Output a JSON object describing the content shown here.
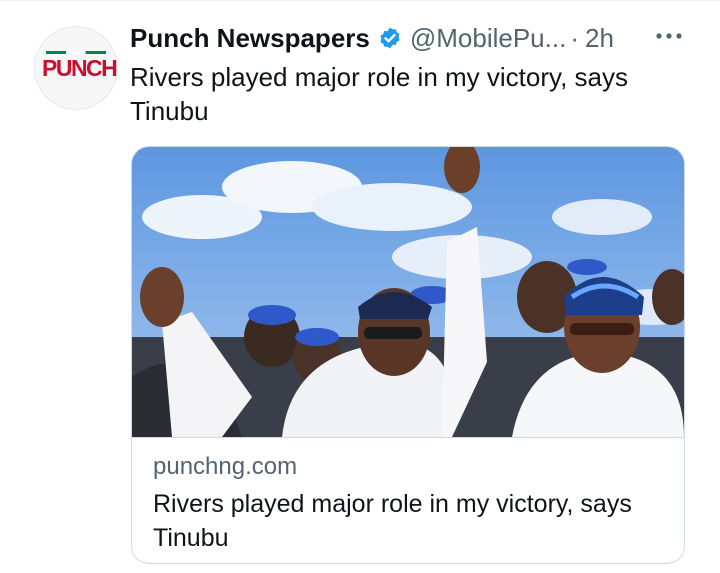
{
  "tweet": {
    "author_name": "Punch Newspapers",
    "handle": "@MobilePu...",
    "separator": "·",
    "time": "2h",
    "text": "Rivers played major role in my victory, says Tinubu",
    "avatar_label": "PUNCH",
    "verified_icon": "verified-badge-icon",
    "more_icon": "more-horizontal-icon"
  },
  "link_card": {
    "domain": "punchng.com",
    "title": "Rivers played major role in my victory, says Tinubu"
  },
  "colors": {
    "text_primary": "#0f1419",
    "text_secondary": "#536471",
    "verified": "#1d9bf0",
    "border": "#cfd9de",
    "brand_red": "#c8102e"
  }
}
